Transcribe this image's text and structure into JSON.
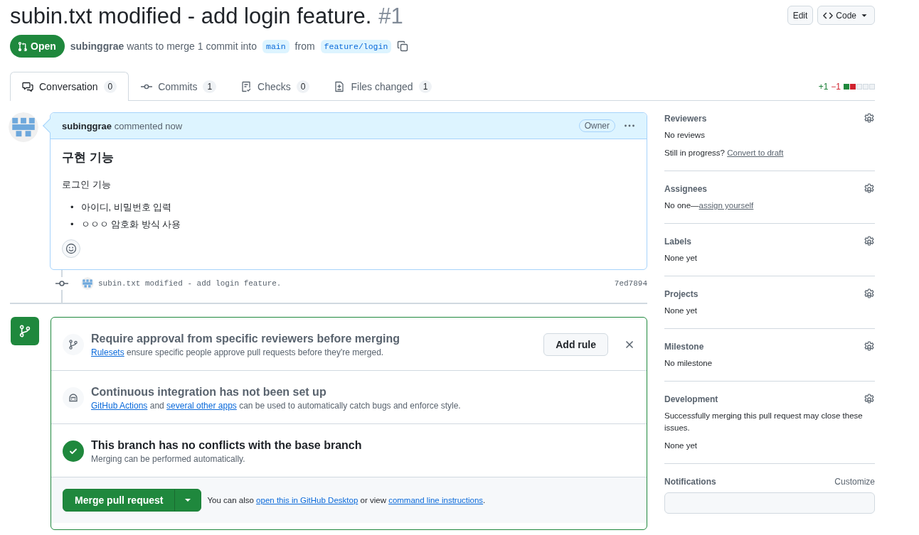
{
  "title": {
    "text": "subin.txt modified - add login feature.",
    "number": "#1"
  },
  "header_buttons": {
    "edit": "Edit",
    "code": "Code"
  },
  "status": {
    "label": "Open",
    "author": "subinggrae",
    "text": "wants to merge 1 commit into",
    "base": "main",
    "from": "from",
    "head": "feature/login"
  },
  "tabs": [
    {
      "label": "Conversation",
      "count": "0",
      "selected": true
    },
    {
      "label": "Commits",
      "count": "1",
      "selected": false
    },
    {
      "label": "Checks",
      "count": "0",
      "selected": false
    },
    {
      "label": "Files changed",
      "count": "1",
      "selected": false
    }
  ],
  "diffstat": {
    "additions": "+1",
    "deletions": "−1",
    "blocks": [
      {
        "kind": "added"
      },
      {
        "kind": "deleted"
      },
      {
        "kind": "neutral"
      },
      {
        "kind": "neutral"
      },
      {
        "kind": "neutral"
      }
    ]
  },
  "comment": {
    "author": "subinggrae",
    "action": "commented now",
    "badge": "Owner",
    "heading": "구현 기능",
    "paragraph": "로그인 기능",
    "bullet": "•",
    "list": [
      "아이디, 비밀번호 입력",
      "ㅇㅇㅇ 암호화 방식 사용"
    ]
  },
  "commit": {
    "message": "subin.txt modified - add login feature.",
    "sha": "7ed7894"
  },
  "merge_box": {
    "sections": [
      {
        "kind": "rule",
        "title": "Require approval from specific reviewers before merging",
        "parts": [
          {
            "text": "Rulesets",
            "link": true
          },
          {
            "text": " ensure specific people approve pull requests before they're merged.",
            "link": false
          }
        ],
        "action": "Add rule"
      },
      {
        "kind": "ci",
        "title": "Continuous integration has not been set up",
        "parts": [
          {
            "text": "GitHub Actions",
            "link": true
          },
          {
            "text": " and ",
            "link": false
          },
          {
            "text": "several other apps",
            "link": true
          },
          {
            "text": " can be used to automatically catch bugs and enforce style.",
            "link": false
          }
        ]
      },
      {
        "kind": "ok",
        "title": "This branch has no conflicts with the base branch",
        "parts": [
          {
            "text": "Merging can be performed automatically.",
            "link": false
          }
        ]
      }
    ],
    "merge_button": "Merge pull request",
    "note_parts": [
      {
        "text": "You can also ",
        "link": false
      },
      {
        "text": "open this in GitHub Desktop",
        "link": true
      },
      {
        "text": " or view ",
        "link": false
      },
      {
        "text": "command line instructions",
        "link": true
      },
      {
        "text": ".",
        "link": false
      }
    ]
  },
  "sidebar": {
    "sections": [
      {
        "title": "Reviewers",
        "lines": [
          [
            {
              "text": "No reviews",
              "link": false
            }
          ],
          [
            {
              "text": "Still in progress? ",
              "link": false
            },
            {
              "text": "Convert to draft",
              "link": true
            }
          ]
        ]
      },
      {
        "title": "Assignees",
        "lines": [
          [
            {
              "text": "No one—",
              "link": false
            },
            {
              "text": "assign yourself",
              "link": true
            }
          ]
        ]
      },
      {
        "title": "Labels",
        "lines": [
          [
            {
              "text": "None yet",
              "link": false
            }
          ]
        ]
      },
      {
        "title": "Projects",
        "lines": [
          [
            {
              "text": "None yet",
              "link": false
            }
          ]
        ]
      },
      {
        "title": "Milestone",
        "lines": [
          [
            {
              "text": "No milestone",
              "link": false
            }
          ]
        ]
      },
      {
        "title": "Development",
        "lines": [
          [
            {
              "text": "Successfully merging this pull request may close these issues.",
              "link": false
            }
          ],
          [
            {
              "text": "None yet",
              "link": false
            }
          ]
        ]
      },
      {
        "title": "Notifications",
        "action": "Customize"
      }
    ]
  }
}
